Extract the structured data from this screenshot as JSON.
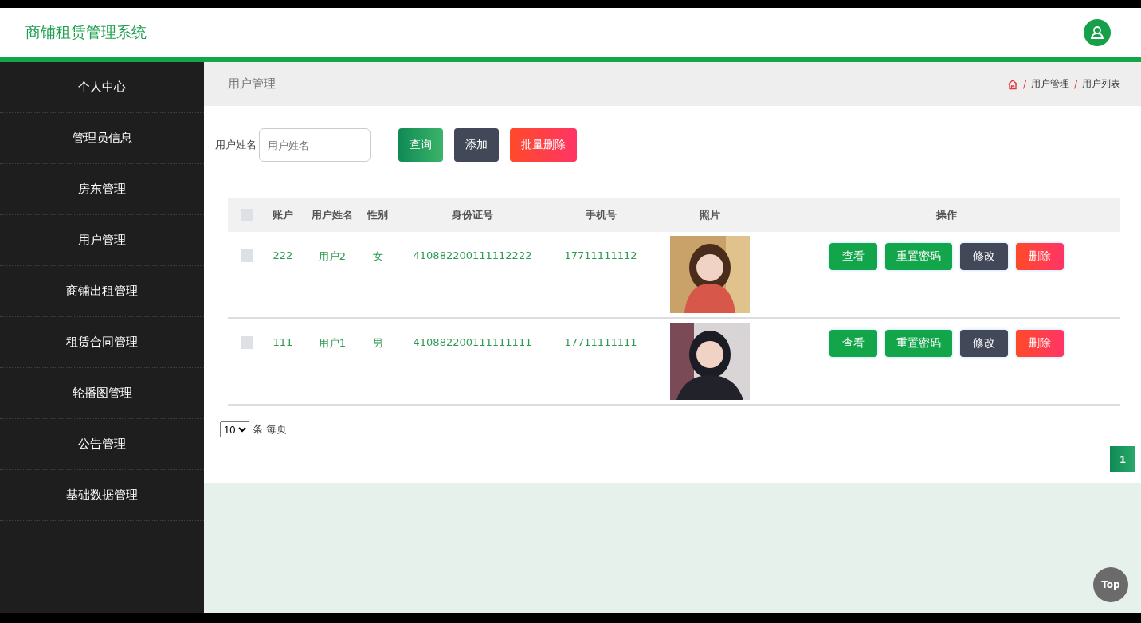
{
  "header": {
    "title": "商铺租赁管理系统"
  },
  "sidebar": {
    "items": [
      {
        "label": "个人中心",
        "selected": false
      },
      {
        "label": "管理员信息",
        "selected": false
      },
      {
        "label": "房东管理",
        "selected": false
      },
      {
        "label": "用户管理",
        "selected": false
      },
      {
        "label": "商铺出租管理",
        "selected": false
      },
      {
        "label": "租赁合同管理",
        "selected": false
      },
      {
        "label": "轮播图管理",
        "selected": false
      },
      {
        "label": "公告管理",
        "selected": false
      },
      {
        "label": "基础数据管理",
        "selected": false
      }
    ]
  },
  "page_title": "用户管理",
  "breadcrumb": {
    "separator": "/",
    "items": [
      "用户管理",
      "用户列表"
    ]
  },
  "search": {
    "label": "用户姓名",
    "placeholder": "用户姓名"
  },
  "toolbar_buttons": [
    {
      "label": "查询",
      "kind": "search"
    },
    {
      "label": "添加",
      "kind": "add"
    },
    {
      "label": "批量删除",
      "kind": "delete"
    }
  ],
  "table": {
    "all_checked": false,
    "columns": [
      "账户",
      "用户姓名",
      "性别",
      "身份证号",
      "手机号",
      "照片",
      "操作"
    ],
    "rows": [
      {
        "checked": false,
        "cells": [
          "222",
          "用户2",
          "女",
          "410882200111112222",
          "17711111112"
        ],
        "photo": {
          "kind": "picture"
        },
        "actions": [
          {
            "label": "查看",
            "kind": "view"
          },
          {
            "label": "重置密码",
            "kind": "reset"
          },
          {
            "label": "修改",
            "kind": "edit"
          },
          {
            "label": "删除",
            "kind": "delete"
          }
        ]
      },
      {
        "checked": false,
        "cells": [
          "111",
          "用户1",
          "男",
          "410882200111111111",
          "17711111111"
        ],
        "photo": {
          "kind": "picture"
        },
        "actions": [
          {
            "label": "查看",
            "kind": "view"
          },
          {
            "label": "重置密码",
            "kind": "reset"
          },
          {
            "label": "修改",
            "kind": "edit"
          },
          {
            "label": "删除",
            "kind": "delete"
          }
        ]
      }
    ]
  },
  "page_size": {
    "value": "10",
    "label": "条 每页"
  },
  "pagination": [
    {
      "label": "1",
      "selected": true
    }
  ],
  "back_to_top": "Top"
}
